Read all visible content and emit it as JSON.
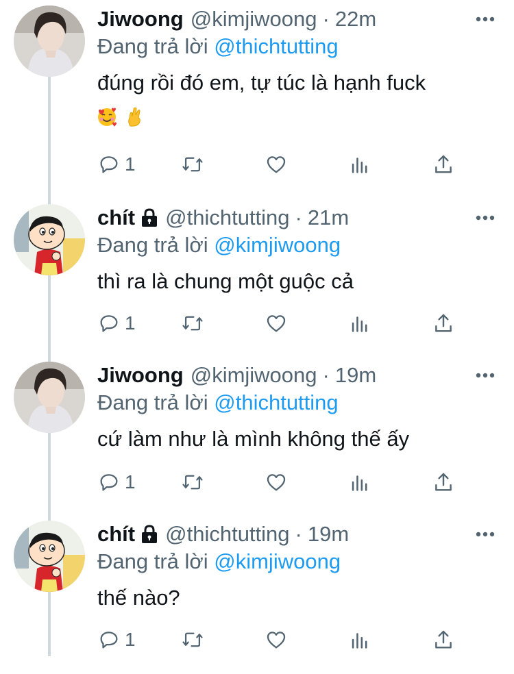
{
  "tweets": [
    {
      "name": "Jiwoong",
      "handle": "@kimjiwoong",
      "time": "22m",
      "locked": false,
      "reply_prefix": "Đang trả lời",
      "reply_to": "@thichtutting",
      "text": "đúng rồi đó em, tự túc là hạnh fuck",
      "emojis": [
        "smiling-face-with-hearts",
        "crossed-fingers"
      ],
      "reply_count": "1",
      "avatar": "portrait-photo"
    },
    {
      "name": "chít",
      "handle": "@thichtutting",
      "time": "21m",
      "locked": true,
      "reply_prefix": "Đang trả lời",
      "reply_to": "@kimjiwoong",
      "text": "thì ra là chung một guộc cả",
      "emojis": [],
      "reply_count": "1",
      "avatar": "cartoon-character"
    },
    {
      "name": "Jiwoong",
      "handle": "@kimjiwoong",
      "time": "19m",
      "locked": false,
      "reply_prefix": "Đang trả lời",
      "reply_to": "@thichtutting",
      "text": "cứ làm như là mình không thế ấy",
      "emojis": [],
      "reply_count": "1",
      "avatar": "portrait-photo"
    },
    {
      "name": "chít",
      "handle": "@thichtutting",
      "time": "19m",
      "locked": true,
      "reply_prefix": "Đang trả lời",
      "reply_to": "@kimjiwoong",
      "text": "thế nào?",
      "emojis": [],
      "reply_count": "1",
      "avatar": "cartoon-character"
    }
  ],
  "icons": {
    "reply": "reply-icon",
    "retweet": "retweet-icon",
    "like": "like-icon",
    "analytics": "analytics-icon",
    "share": "share-icon",
    "more": "more-icon",
    "lock": "lock-icon"
  },
  "colors": {
    "text": "#0f1419",
    "secondary": "#536471",
    "accent": "#1d9bf0",
    "thread_line": "#cfd9de"
  }
}
